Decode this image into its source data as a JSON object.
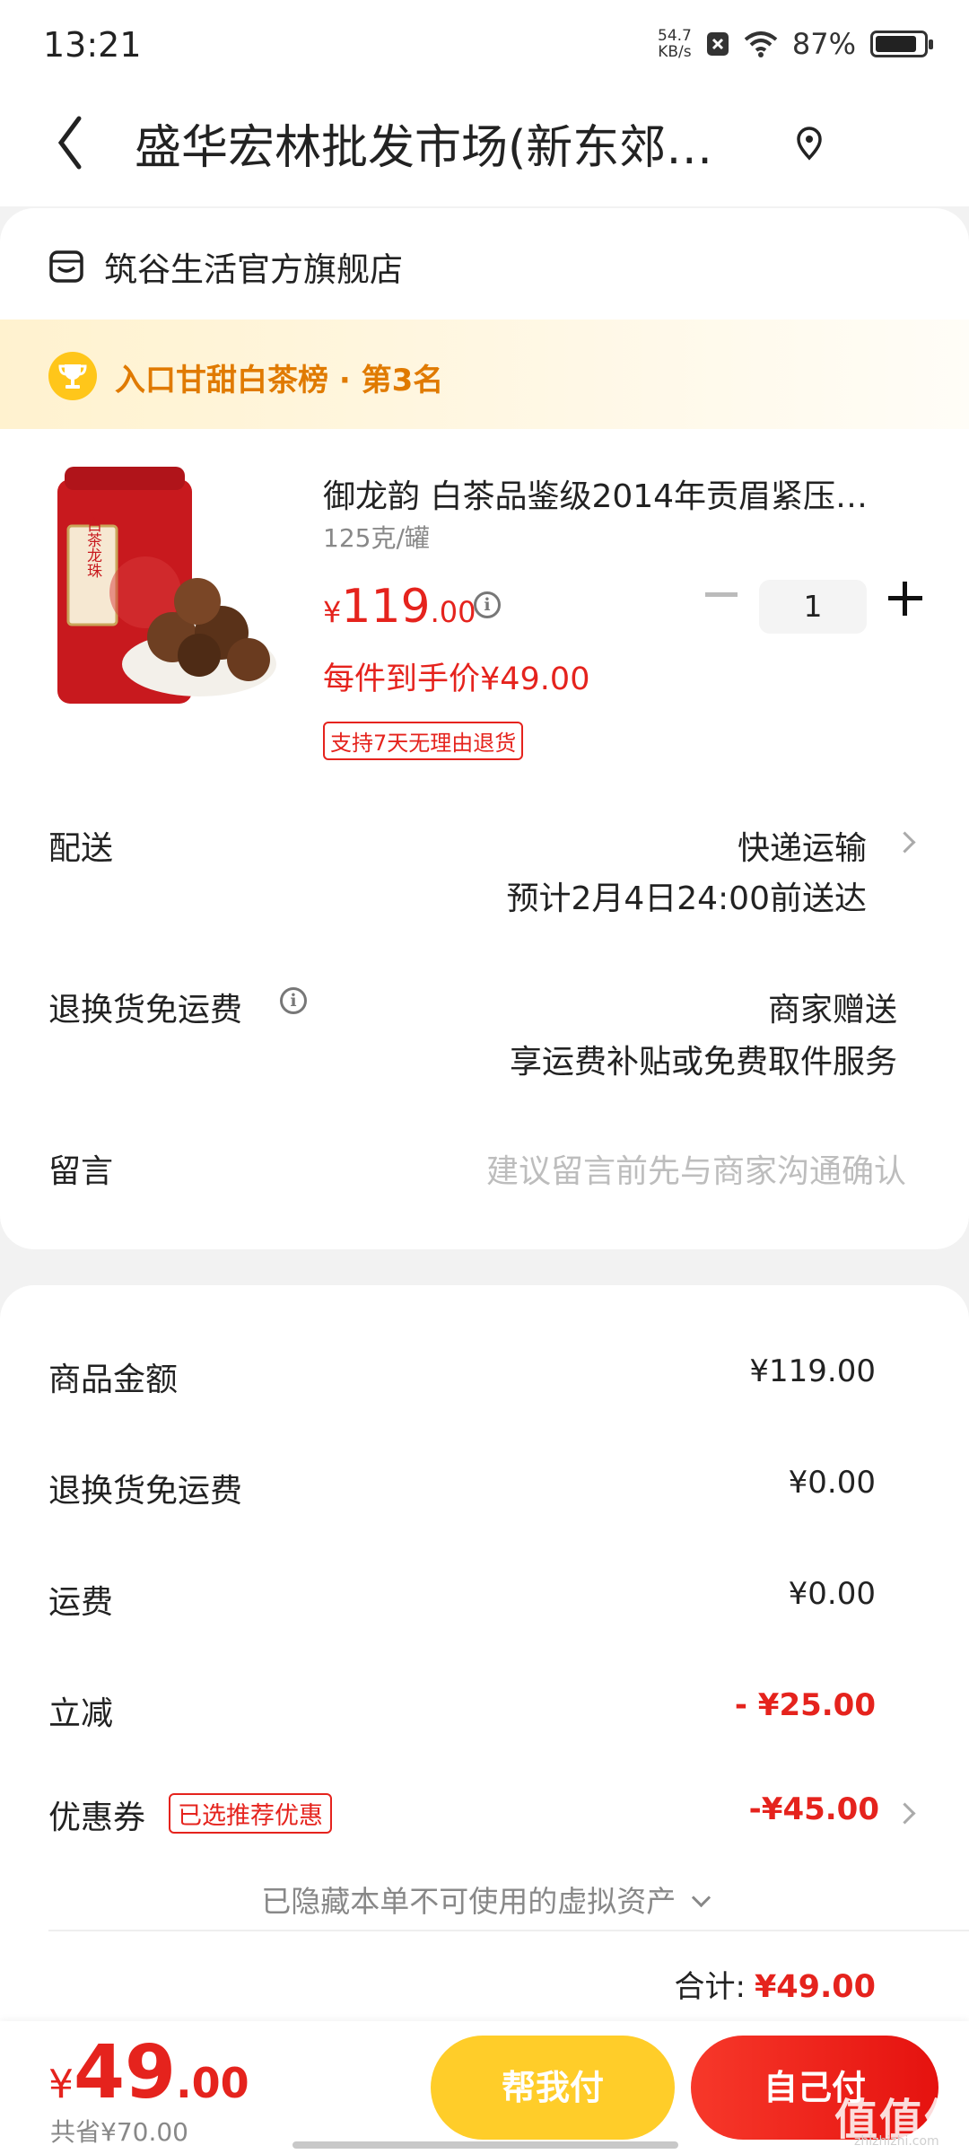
{
  "status_bar": {
    "time": "13:21",
    "net_speed_value": "54.7",
    "net_speed_unit": "KB/s",
    "battery": "87%",
    "battery_level": 0.87
  },
  "header": {
    "title": "盛华宏林批发市场(新东郊…"
  },
  "store": {
    "name": "筑谷生活官方旗舰店"
  },
  "rank": {
    "text": "入口甘甜白茶榜 · 第3名"
  },
  "product": {
    "title": "御龙韵 白茶品鉴级2014年贡眉紧压…",
    "spec": "125克/罐",
    "price_symbol": "¥",
    "price_int": "119",
    "price_dec": ".00",
    "unit_price": "每件到手价¥49.00",
    "return_badge": "支持7天无理由退货",
    "quantity": "1",
    "image_label": "白茶龙珠"
  },
  "delivery": {
    "label": "配送",
    "method": "快递运输",
    "eta": "预计2月4日24:00前送达"
  },
  "return_shipping": {
    "label": "退换货免运费",
    "value": "商家赠送",
    "desc": "享运费补贴或免费取件服务"
  },
  "remark": {
    "label": "留言",
    "placeholder": "建议留言前先与商家沟通确认"
  },
  "summary": {
    "items": [
      {
        "label": "商品金额",
        "value": "¥119.00"
      },
      {
        "label": "退换货免运费",
        "value": "¥0.00"
      },
      {
        "label": "运费",
        "value": "¥0.00"
      },
      {
        "label": "立减",
        "value": "- ¥25.00"
      }
    ],
    "coupon": {
      "label": "优惠券",
      "tag": "已选推荐优惠",
      "value": "-¥45.00"
    },
    "hidden_assets": "已隐藏本单不可使用的虚拟资产",
    "total_label": "合计:",
    "total_value": "¥49.00"
  },
  "bottom": {
    "price_symbol": "¥",
    "price_int": "49",
    "price_dec": ".00",
    "saved": "共省¥70.00",
    "help_pay": "帮我付",
    "self_pay": "自己付",
    "watermark": "值值值",
    "watermark_sub": "zhizhizhi.com"
  },
  "colors": {
    "accent_red": "#e5231d",
    "accent_yellow": "#ffcd29",
    "rank_orange": "#e07a00"
  }
}
